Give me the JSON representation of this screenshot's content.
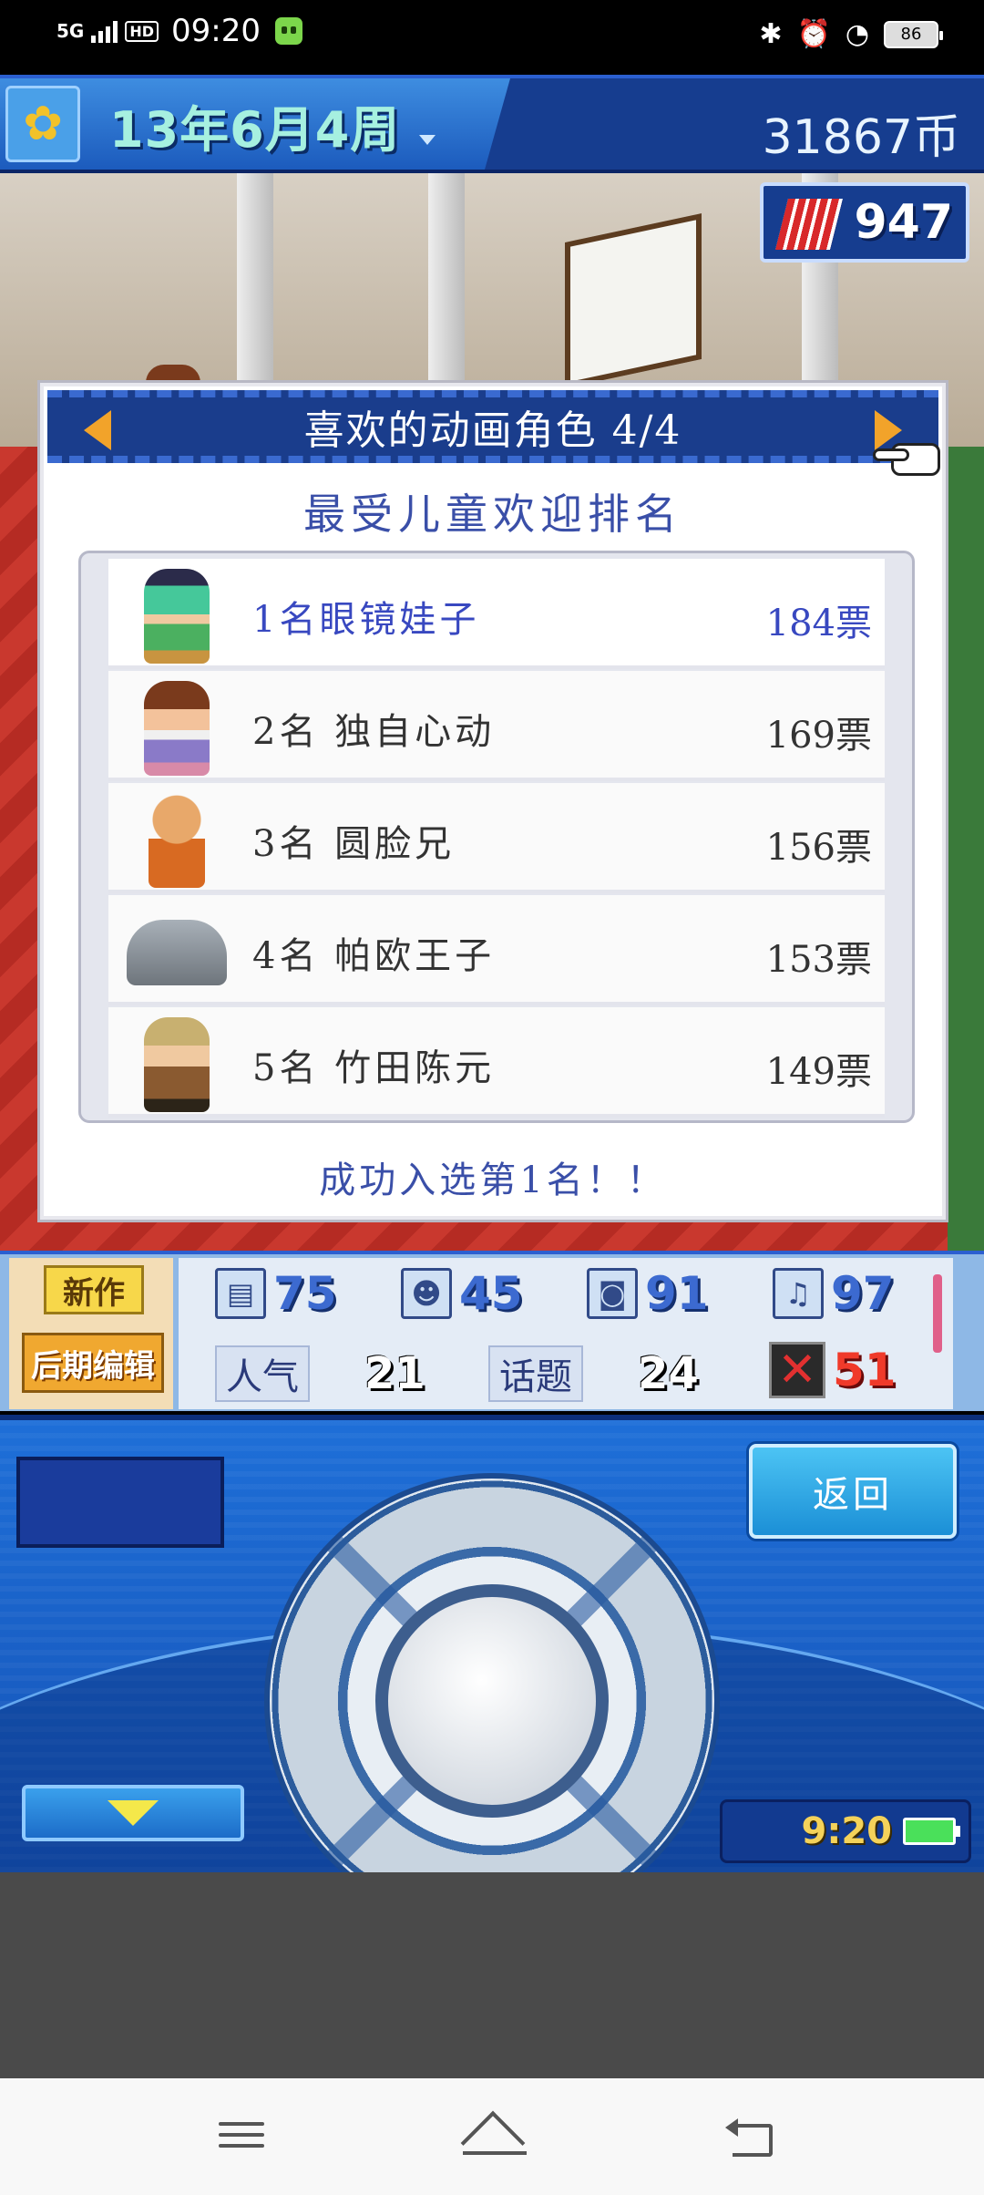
{
  "status_bar": {
    "network": "5G",
    "hd": "HD",
    "time": "09:20",
    "battery": "86"
  },
  "top_bar": {
    "date": "13年6月4周",
    "money": "31867币",
    "tickets": "947"
  },
  "dialog": {
    "title": "喜欢的动画角色 4/4",
    "subtitle": "最受儿童欢迎排名",
    "rankings": [
      {
        "rank_name": "1名眼镜娃子",
        "votes": "184票",
        "selected": true
      },
      {
        "rank_name": "2名 独自心动",
        "votes": "169票",
        "selected": false
      },
      {
        "rank_name": "3名 圆脸兄",
        "votes": "156票",
        "selected": false
      },
      {
        "rank_name": "4名 帕欧王子",
        "votes": "153票",
        "selected": false
      },
      {
        "rank_name": "5名 竹田陈元",
        "votes": "149票",
        "selected": false
      }
    ],
    "footer": "成功入选第1名！！"
  },
  "stats": {
    "tag_new": "新作",
    "tag_edit": "后期编辑",
    "script": "75",
    "cast": "45",
    "camera": "91",
    "music": "97",
    "popularity_label": "人气",
    "popularity": "21",
    "topic_label": "话题",
    "topic": "24",
    "bugs": "51"
  },
  "controller": {
    "back_label": "返回",
    "clock": "9:20"
  },
  "colors": {
    "accent_blue": "#1a3d8c",
    "selected_text": "#3848c0",
    "arrow_orange": "#f2a32a"
  }
}
